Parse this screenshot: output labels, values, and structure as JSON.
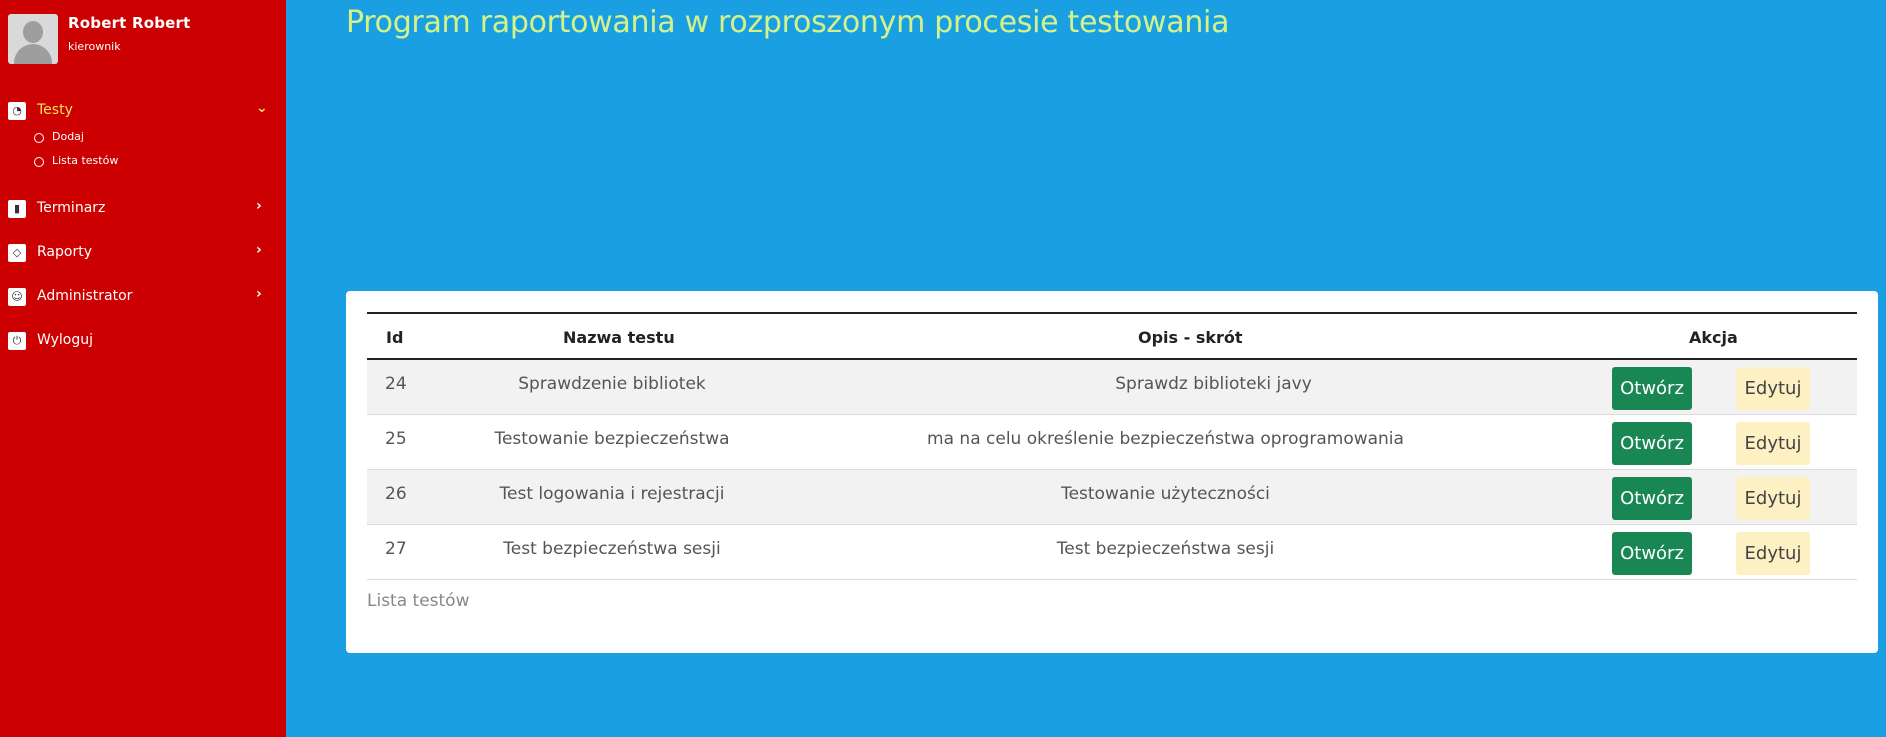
{
  "user": {
    "name": "Robert Robert",
    "role": "kierownik"
  },
  "nav": {
    "items": [
      {
        "label": "Testy",
        "icon": "dashboard-icon",
        "active": true,
        "sub": [
          {
            "label": "Dodaj"
          },
          {
            "label": "Lista testów"
          }
        ]
      },
      {
        "label": "Terminarz",
        "icon": "file-icon"
      },
      {
        "label": "Raporty",
        "icon": "diamond-icon"
      },
      {
        "label": "Administrator",
        "icon": "smile-icon"
      },
      {
        "label": "Wyloguj",
        "icon": "power-icon"
      }
    ]
  },
  "main": {
    "title": "Program raportowania w rozproszonym procesie testowania",
    "table": {
      "headers": {
        "id": "Id",
        "name": "Nazwa testu",
        "desc": "Opis - skrót",
        "action": "Akcja"
      },
      "rows": [
        {
          "id": "24",
          "name": "Sprawdzenie bibliotek",
          "desc": "Sprawdz biblioteki javy"
        },
        {
          "id": "25",
          "name": "Testowanie bezpieczeństwa",
          "desc": "ma na celu określenie bezpieczeństwa oprogramowania"
        },
        {
          "id": "26",
          "name": "Test logowania i rejestracji",
          "desc": "Testowanie użyteczności"
        },
        {
          "id": "27",
          "name": "Test bezpieczeństwa sesji",
          "desc": "Test bezpieczeństwa sesji"
        }
      ],
      "open_label": "Otwórz",
      "edit_label": "Edytuj",
      "caption": "Lista testów"
    }
  },
  "colors": {
    "sidebar": "#cc0000",
    "background": "#1aa0e2",
    "title": "#d4f28a",
    "active": "#f5e35a",
    "open_btn": "#198754",
    "edit_btn": "#fdf0c2"
  }
}
